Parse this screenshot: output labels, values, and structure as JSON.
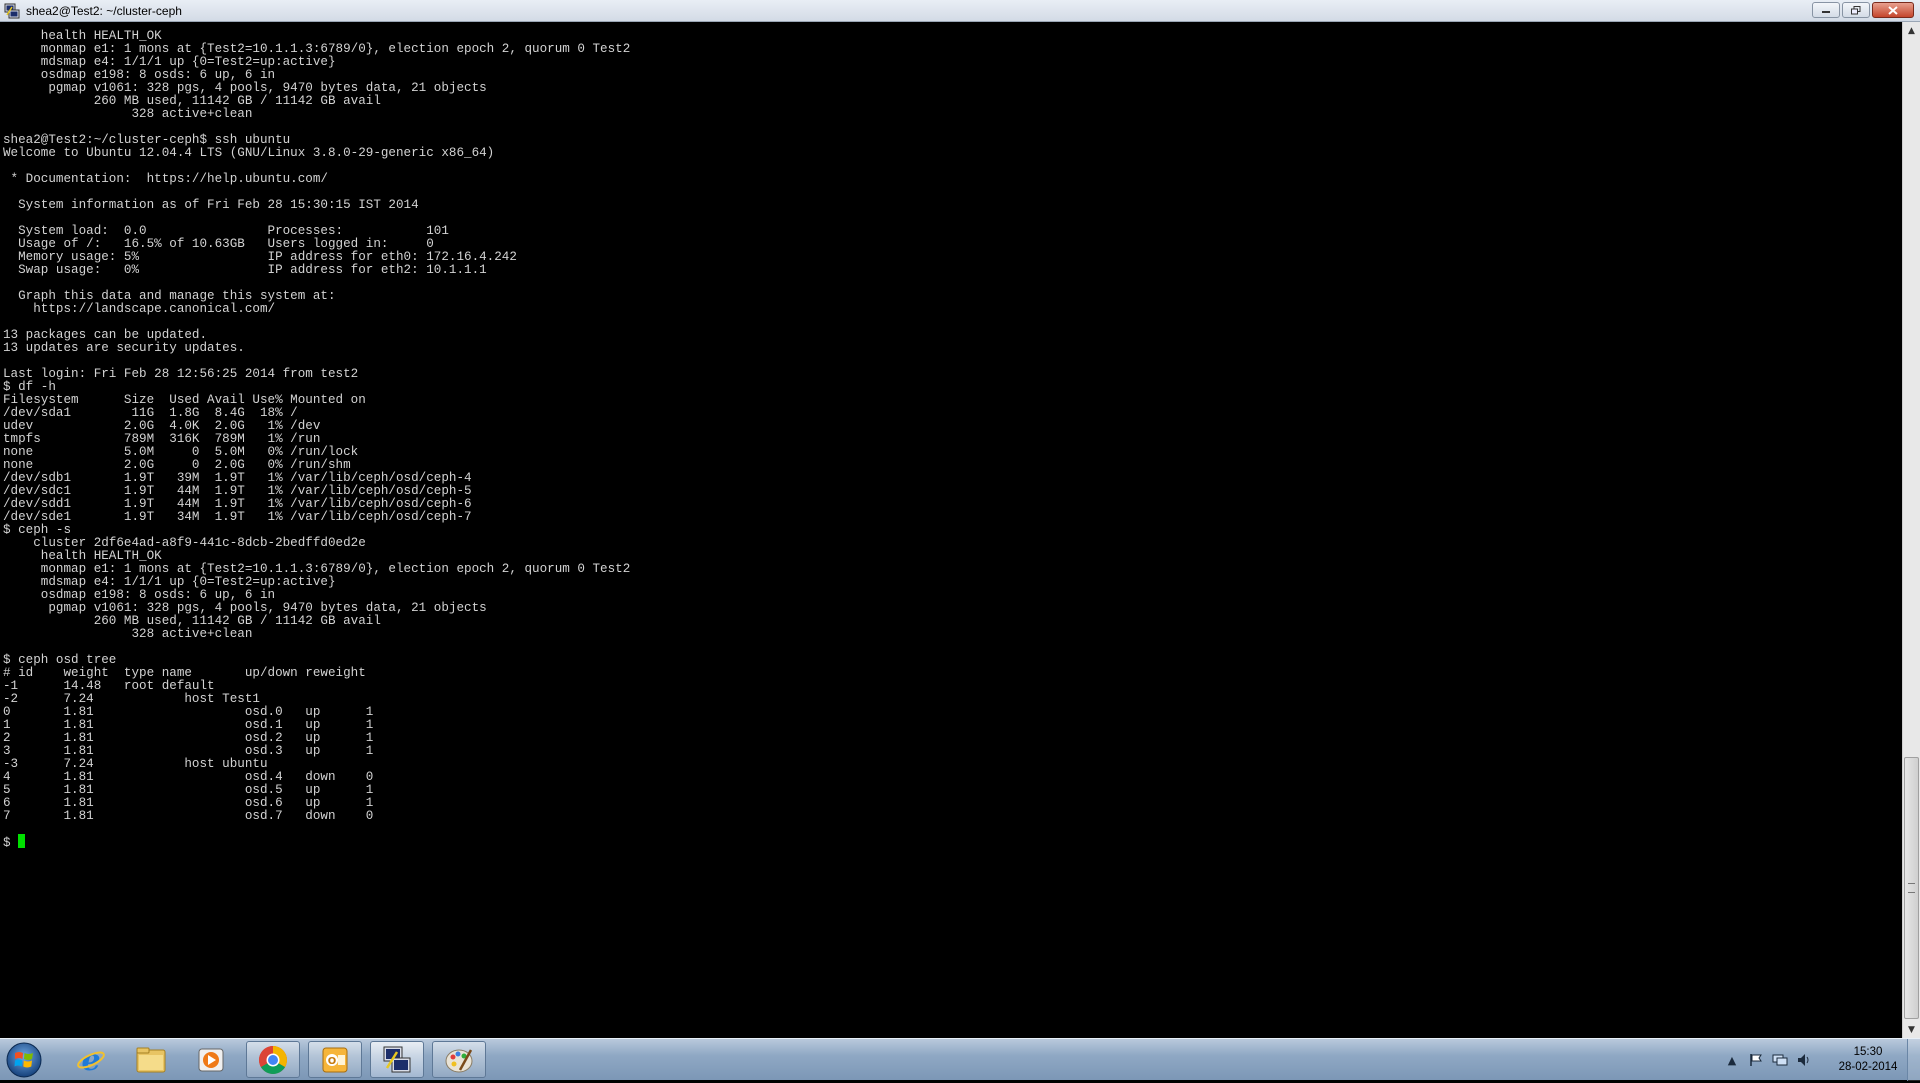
{
  "window": {
    "title": "shea2@Test2: ~/cluster-ceph",
    "minimize_icon": "minimize-icon",
    "maximize_icon": "restore-icon",
    "close_icon": "close-icon"
  },
  "terminal": {
    "prompt_cursor_color": "#00e000",
    "lines": [
      "     health HEALTH_OK",
      "     monmap e1: 1 mons at {Test2=10.1.1.3:6789/0}, election epoch 2, quorum 0 Test2",
      "     mdsmap e4: 1/1/1 up {0=Test2=up:active}",
      "     osdmap e198: 8 osds: 6 up, 6 in",
      "      pgmap v1061: 328 pgs, 4 pools, 9470 bytes data, 21 objects",
      "            260 MB used, 11142 GB / 11142 GB avail",
      "                 328 active+clean",
      "",
      "shea2@Test2:~/cluster-ceph$ ssh ubuntu",
      "Welcome to Ubuntu 12.04.4 LTS (GNU/Linux 3.8.0-29-generic x86_64)",
      "",
      " * Documentation:  https://help.ubuntu.com/",
      "",
      "  System information as of Fri Feb 28 15:30:15 IST 2014",
      "",
      "  System load:  0.0                Processes:           101",
      "  Usage of /:   16.5% of 10.63GB   Users logged in:     0",
      "  Memory usage: 5%                 IP address for eth0: 172.16.4.242",
      "  Swap usage:   0%                 IP address for eth2: 10.1.1.1",
      "",
      "  Graph this data and manage this system at:",
      "    https://landscape.canonical.com/",
      "",
      "13 packages can be updated.",
      "13 updates are security updates.",
      "",
      "Last login: Fri Feb 28 12:56:25 2014 from test2",
      "$ df -h",
      "Filesystem      Size  Used Avail Use% Mounted on",
      "/dev/sda1        11G  1.8G  8.4G  18% /",
      "udev            2.0G  4.0K  2.0G   1% /dev",
      "tmpfs           789M  316K  789M   1% /run",
      "none            5.0M     0  5.0M   0% /run/lock",
      "none            2.0G     0  2.0G   0% /run/shm",
      "/dev/sdb1       1.9T   39M  1.9T   1% /var/lib/ceph/osd/ceph-4",
      "/dev/sdc1       1.9T   44M  1.9T   1% /var/lib/ceph/osd/ceph-5",
      "/dev/sdd1       1.9T   44M  1.9T   1% /var/lib/ceph/osd/ceph-6",
      "/dev/sde1       1.9T   34M  1.9T   1% /var/lib/ceph/osd/ceph-7",
      "$ ceph -s",
      "    cluster 2df6e4ad-a8f9-441c-8dcb-2bedffd0ed2e",
      "     health HEALTH_OK",
      "     monmap e1: 1 mons at {Test2=10.1.1.3:6789/0}, election epoch 2, quorum 0 Test2",
      "     mdsmap e4: 1/1/1 up {0=Test2=up:active}",
      "     osdmap e198: 8 osds: 6 up, 6 in",
      "      pgmap v1061: 328 pgs, 4 pools, 9470 bytes data, 21 objects",
      "            260 MB used, 11142 GB / 11142 GB avail",
      "                 328 active+clean",
      "",
      "$ ceph osd tree",
      "# id    weight  type name       up/down reweight",
      "-1      14.48   root default",
      "-2      7.24            host Test1",
      "0       1.81                    osd.0   up      1",
      "1       1.81                    osd.1   up      1",
      "2       1.81                    osd.2   up      1",
      "3       1.81                    osd.3   up      1",
      "-3      7.24            host ubuntu",
      "4       1.81                    osd.4   down    0",
      "5       1.81                    osd.5   up      1",
      "6       1.81                    osd.6   up      1",
      "7       1.81                    osd.7   down    0",
      "",
      "$ "
    ]
  },
  "scrollbar": {
    "up_icon": "scroll-up-arrow-icon",
    "down_icon": "scroll-down-arrow-icon",
    "position": 1.0
  },
  "taskbar": {
    "start_icon": "windows-start-icon",
    "pinned": [
      {
        "name": "internet-explorer-icon",
        "running": false
      },
      {
        "name": "file-explorer-icon",
        "running": false
      },
      {
        "name": "media-player-icon",
        "running": false
      },
      {
        "name": "chrome-icon",
        "running": true
      },
      {
        "name": "outlook-icon",
        "running": true
      },
      {
        "name": "putty-icon",
        "running": true,
        "active": true
      },
      {
        "name": "paint-icon",
        "running": true
      }
    ],
    "tray": {
      "icons": [
        "show-hidden-icons-chevron",
        "action-center-flag-icon",
        "network-icon",
        "volume-icon"
      ]
    },
    "clock": {
      "time": "15:30",
      "date": "28-02-2014"
    }
  }
}
